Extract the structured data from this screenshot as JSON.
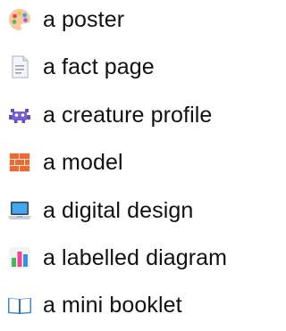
{
  "items": [
    {
      "icon": "artist-palette-icon",
      "label": "a poster"
    },
    {
      "icon": "page-facing-up-icon",
      "label": "a fact page"
    },
    {
      "icon": "alien-monster-icon",
      "label": "a creature profile"
    },
    {
      "icon": "brick-icon",
      "label": "a model"
    },
    {
      "icon": "laptop-icon",
      "label": "a digital design"
    },
    {
      "icon": "bar-chart-icon",
      "label": "a labelled diagram"
    },
    {
      "icon": "open-book-icon",
      "label": "a mini booklet"
    }
  ]
}
